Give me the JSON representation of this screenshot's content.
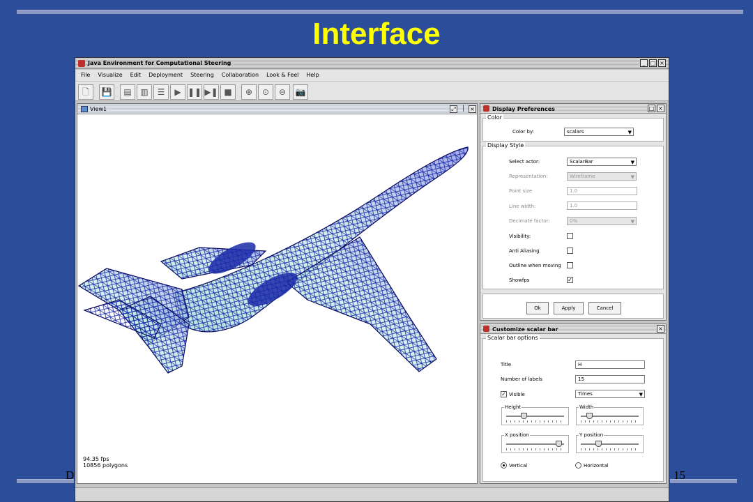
{
  "slide": {
    "title": "Interface",
    "footer_left": "D",
    "page_number": "15"
  },
  "app": {
    "window_title": "Java Environment for Computational Steering",
    "window_buttons": [
      "_",
      "□",
      "×"
    ],
    "menu": [
      "File",
      "Visualize",
      "Edit",
      "Deployment",
      "Steering",
      "Collaboration",
      "Look & Feel",
      "Help"
    ],
    "toolbar_icons": [
      "new-file-icon",
      "save-icon",
      "open-icon",
      "book-icon",
      "list-icon",
      "play-icon",
      "pause-icon",
      "step-icon",
      "stop-icon",
      "zoom-in-icon",
      "zoom-fit-icon",
      "zoom-out-icon",
      "camera-icon"
    ]
  },
  "view": {
    "title": "View1",
    "fps": "94.35 fps",
    "polygons": "10856 polygons"
  },
  "display_prefs": {
    "title": "Display Preferences",
    "color_group": "Color",
    "color_by_label": "Color by:",
    "color_by_value": "scalars",
    "style_group": "Display Style",
    "select_actor_label": "Select actor:",
    "select_actor_value": "ScalarBar",
    "representation_label": "Representation:",
    "representation_value": "Wireframe",
    "point_size_label": "Point size",
    "point_size_value": "1.0",
    "line_width_label": "Line width:",
    "line_width_value": "1.0",
    "decimate_label": "Decimate factor:",
    "decimate_value": "0%",
    "visibility_label": "Visibility:",
    "visibility_checked": false,
    "anti_aliasing_label": "Anti Aliasing",
    "anti_aliasing_checked": false,
    "outline_label": "Outline when moving",
    "outline_checked": false,
    "showfps_label": "Showfps",
    "showfps_checked": true,
    "ok": "Ok",
    "apply": "Apply",
    "cancel": "Cancel"
  },
  "scalar_bar": {
    "title": "Customize scalar bar",
    "group": "Scalar bar options",
    "title_label": "Title",
    "title_value": "H",
    "labels_label": "Number of labels",
    "labels_value": "15",
    "visible_label": "Visible",
    "visible_checked": true,
    "font_value": "Times",
    "height_label": "Height",
    "height_level": 0.3,
    "width_label": "Width",
    "width_level": 0.15,
    "xpos_label": "X position",
    "xpos_level": 0.9,
    "ypos_label": "Y position",
    "ypos_level": 0.3,
    "vertical_label": "Vertical",
    "horizontal_label": "Horizontal",
    "orientation": "vertical"
  }
}
